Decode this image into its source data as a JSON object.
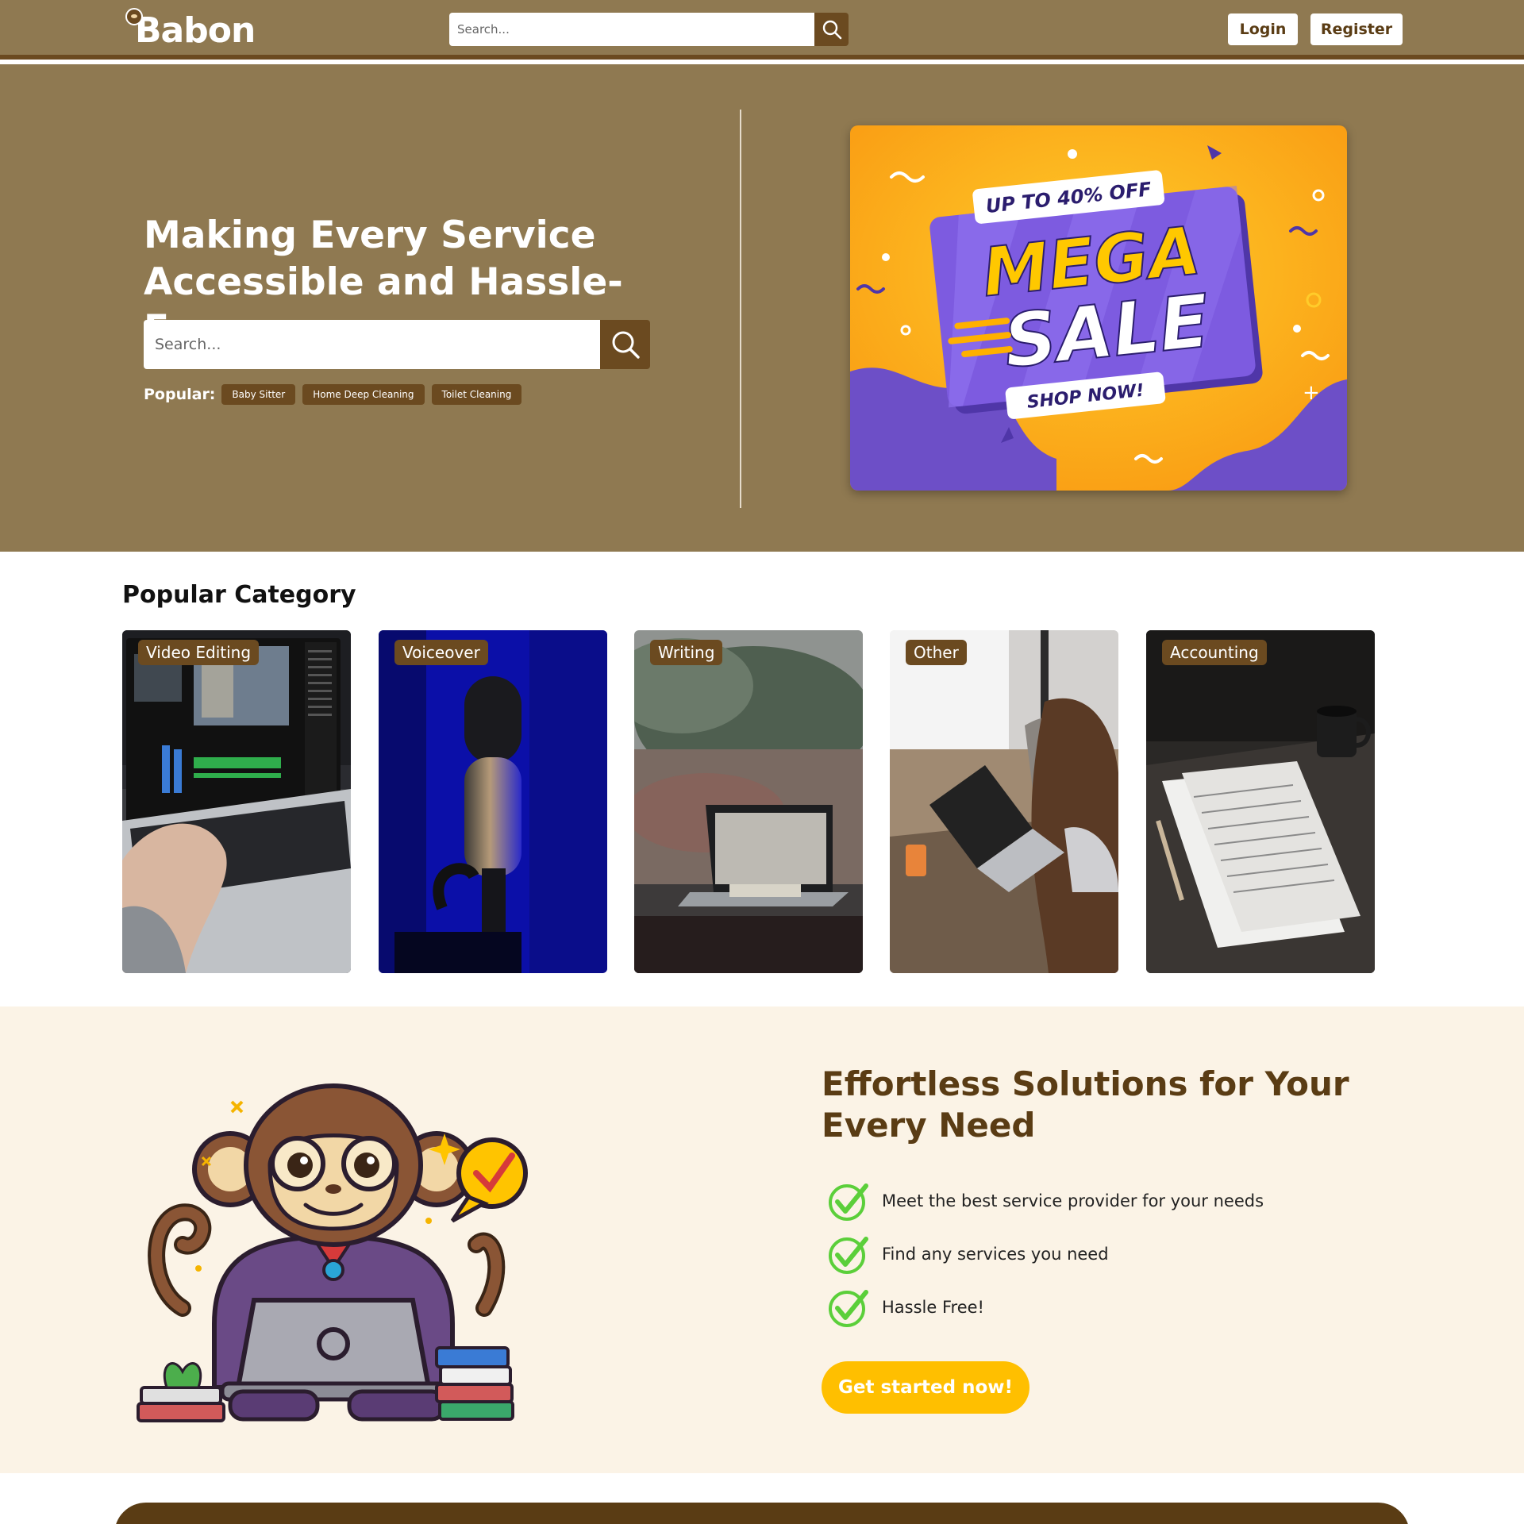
{
  "nav": {
    "logo": "Babon",
    "search_placeholder": "Search...",
    "login": "Login",
    "register": "Register"
  },
  "hero": {
    "title": "Making Every Service Accessible and Hassle-Free",
    "search_placeholder": "Search...",
    "popular_label": "Popular:",
    "popular_tags": [
      "Baby Sitter",
      "Home Deep Cleaning",
      "Toilet Cleaning"
    ]
  },
  "banner": {
    "top": "UP TO 40% OFF",
    "line1": "MEGA",
    "line2": "SALE",
    "bottom": "SHOP NOW!"
  },
  "categories": {
    "title": "Popular Category",
    "items": [
      "Video Editing",
      "Voiceover",
      "Writing",
      "Other",
      "Accounting"
    ]
  },
  "solutions": {
    "title": "Effortless Solutions for Your Every Need",
    "points": [
      "Meet the best service provider for your needs",
      "Find any services you need",
      "Hassle Free!"
    ],
    "cta": "Get started now!"
  },
  "colors": {
    "brand_tan": "#8f7951",
    "brand_brown": "#6b4a20",
    "cta_yellow": "#ffbf00",
    "cream": "#fbf3e6"
  },
  "icons": [
    "search-icon",
    "check-icon"
  ]
}
